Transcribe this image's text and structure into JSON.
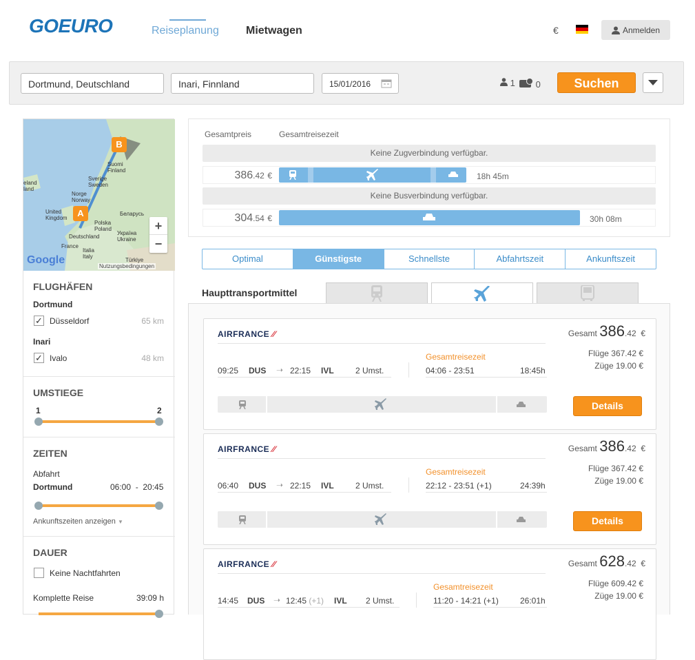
{
  "header": {
    "logo": "GOEURO",
    "nav": [
      "Reiseplanung",
      "Mietwagen"
    ],
    "currency": "€",
    "login": "Anmelden"
  },
  "search": {
    "from": "Dortmund, Deutschland",
    "to": "Inari, Finnland",
    "date": "15/01/2016",
    "adults": "1",
    "discounts": "0",
    "button": "Suchen"
  },
  "map": {
    "labels": [
      "Suomi\nFinland",
      "Sverige\nSweden",
      "Norge\nNorway",
      "United\nKingdom",
      "Deutschland",
      "Polska\nPoland",
      "Україна\nUkraine",
      "Беларусь",
      "France",
      "Italia\nItaly",
      "Türkiye",
      "Island"
    ],
    "marker_a": "A",
    "marker_b": "B",
    "zoom_in": "+",
    "zoom_out": "−",
    "google": "Google",
    "terms": "Nutzungsbedingungen"
  },
  "filters": {
    "airports_title": "FLUGHÄFEN",
    "dep_city": "Dortmund",
    "dep_airport": "Düsseldorf",
    "dep_dist": "65 km",
    "arr_city": "Inari",
    "arr_airport": "Ivalo",
    "arr_dist": "48 km",
    "stops_title": "UMSTIEGE",
    "stops_min": "1",
    "stops_max": "2",
    "times_title": "ZEITEN",
    "dep_label": "Abfahrt",
    "dep_place": "Dortmund",
    "dep_from": "06:00",
    "dep_sep": "-",
    "dep_to": "20:45",
    "arr_link": "Ankunftszeiten anzeigen",
    "duration_title": "DAUER",
    "no_night": "Keine Nachtfahrten",
    "complete_trip": "Komplette Reise",
    "complete_value": "39:09 h"
  },
  "summary": {
    "col_price": "Gesamtpreis",
    "col_time": "Gesamtreisezeit",
    "no_train": "Keine Zugverbindung verfügbar.",
    "flight_price_main": "386",
    "flight_price_dec": ".42",
    "flight_time": "18h 45m",
    "no_bus": "Keine Busverbindung verfügbar.",
    "car_price_main": "304",
    "car_price_dec": ".54",
    "car_time": "30h 08m",
    "euro": "€"
  },
  "sort_tabs": [
    "Optimal",
    "Günstigste",
    "Schnellste",
    "Abfahrtszeit",
    "Ankunftszeit"
  ],
  "sort_active_index": 1,
  "main_transport_label": "Haupttransportmittel",
  "results": [
    {
      "airline": "AIRFRANCE",
      "dep_time": "09:25",
      "dep_code": "DUS",
      "arr_time": "22:15",
      "arr_plus": "",
      "arr_code": "IVL",
      "stops": "2 Umst.",
      "total_label": "Gesamtreisezeit",
      "range": "04:06 - 23:51",
      "duration": "18:45h",
      "total_prefix": "Gesamt",
      "price_main": "386",
      "price_dec": ".42",
      "euro": "€",
      "flights": "Flüge 367.42 €",
      "trains": "Züge 19.00 €",
      "details": "Details"
    },
    {
      "airline": "AIRFRANCE",
      "dep_time": "06:40",
      "dep_code": "DUS",
      "arr_time": "22:15",
      "arr_plus": "",
      "arr_code": "IVL",
      "stops": "2 Umst.",
      "total_label": "Gesamtreisezeit",
      "range": "22:12 - 23:51 (+1)",
      "duration": "24:39h",
      "total_prefix": "Gesamt",
      "price_main": "386",
      "price_dec": ".42",
      "euro": "€",
      "flights": "Flüge 367.42 €",
      "trains": "Züge 19.00 €",
      "details": "Details"
    },
    {
      "airline": "AIRFRANCE",
      "dep_time": "14:45",
      "dep_code": "DUS",
      "arr_time": "12:45",
      "arr_plus": "(+1)",
      "arr_code": "IVL",
      "stops": "2 Umst.",
      "total_label": "Gesamtreisezeit",
      "range": "11:20 - 14:21 (+1)",
      "duration": "26:01h",
      "total_prefix": "Gesamt",
      "price_main": "628",
      "price_dec": ".42",
      "euro": "€",
      "flights": "Flüge 609.42 €",
      "trains": "Züge 19.00 €",
      "details": "Details"
    }
  ]
}
